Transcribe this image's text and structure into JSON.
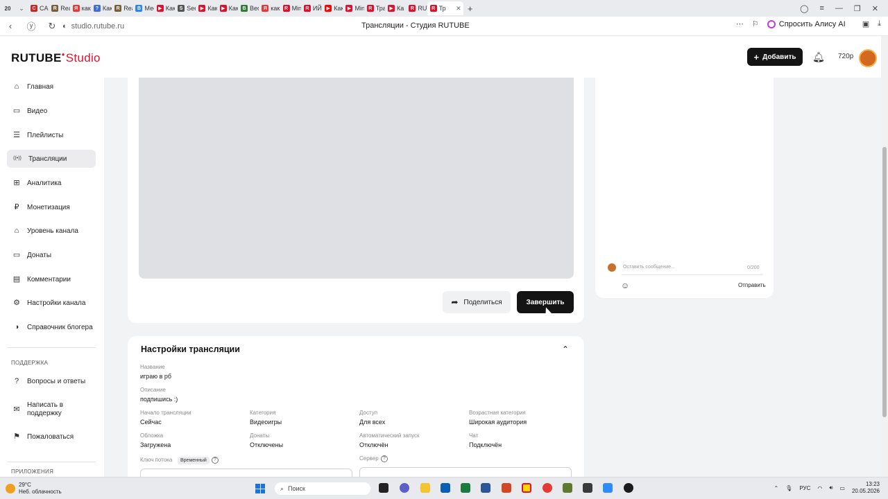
{
  "browser": {
    "tab_counter": "20",
    "tabs": [
      {
        "label": "CAM",
        "color": "#c62828",
        "glyph": "C"
      },
      {
        "label": "Reall",
        "color": "#7b5e3b",
        "glyph": "R"
      },
      {
        "label": "как у",
        "color": "#e53935",
        "glyph": "Я"
      },
      {
        "label": "Как з",
        "color": "#3f6fd8",
        "glyph": "?"
      },
      {
        "label": "Reall",
        "color": "#7b5e3b",
        "glyph": "R"
      },
      {
        "label": "Месс",
        "color": "#2787f5",
        "glyph": "В"
      },
      {
        "label": "Как с",
        "color": "#e0102a",
        "glyph": "▶"
      },
      {
        "label": "Seed",
        "color": "#555555",
        "glyph": "S"
      },
      {
        "label": "Как с",
        "color": "#e0102a",
        "glyph": "▶"
      },
      {
        "label": "Как с",
        "color": "#e0102a",
        "glyph": "▶"
      },
      {
        "label": "Beds",
        "color": "#2e7d32",
        "glyph": "B"
      },
      {
        "label": "как с",
        "color": "#e53935",
        "glyph": "Я"
      },
      {
        "label": "Mine",
        "color": "#e0102a",
        "glyph": "R"
      },
      {
        "label": "ИЙ",
        "color": "#e0102a",
        "glyph": "R"
      },
      {
        "label": "Как н",
        "color": "#ff0000",
        "glyph": "▶"
      },
      {
        "label": "Mine",
        "color": "#e0102a",
        "glyph": "▶"
      },
      {
        "label": "Тран",
        "color": "#e0102a",
        "glyph": "R"
      },
      {
        "label": "Ка м",
        "color": "#e0102a",
        "glyph": "▶"
      },
      {
        "label": "RUTL",
        "color": "#e0102a",
        "glyph": "R"
      }
    ],
    "active_tab": {
      "label": "Тр",
      "color": "#e0102a",
      "glyph": "R"
    },
    "url": "studio.rutube.ru",
    "page_title": "Трансляции - Студия RUTUBE",
    "alice_label": "Спросить Алису AI"
  },
  "header": {
    "logo_main": "RUTUBE",
    "logo_sub": "Studio",
    "add_button": "Добавить",
    "quality": "720p"
  },
  "sidebar": {
    "items": [
      {
        "label": "Главная",
        "icon": "home-icon",
        "glyph": "⌂"
      },
      {
        "label": "Видео",
        "icon": "video-icon",
        "glyph": "▭"
      },
      {
        "label": "Плейлисты",
        "icon": "playlist-icon",
        "glyph": "☰"
      },
      {
        "label": "Трансляции",
        "icon": "broadcast-icon",
        "glyph": "((•))"
      },
      {
        "label": "Аналитика",
        "icon": "analytics-icon",
        "glyph": "⊞"
      },
      {
        "label": "Монетизация",
        "icon": "monetization-icon",
        "glyph": "₽"
      },
      {
        "label": "Уровень канала",
        "icon": "level-icon",
        "glyph": "⌂"
      },
      {
        "label": "Донаты",
        "icon": "donations-icon",
        "glyph": "▭"
      },
      {
        "label": "Комментарии",
        "icon": "comments-icon",
        "glyph": "▤"
      },
      {
        "label": "Настройки канала",
        "icon": "gear-icon",
        "glyph": "⚙"
      },
      {
        "label": "Справочник блогера",
        "icon": "help-book-icon",
        "glyph": "◑"
      }
    ],
    "support_section": "ПОДДЕРЖКА",
    "support_items": [
      {
        "label": "Вопросы и ответы",
        "icon": "faq-icon",
        "glyph": "?"
      },
      {
        "label": "Написать в поддержку",
        "line1": "Написать в",
        "line2": "поддержку",
        "icon": "mail-icon",
        "glyph": "✉"
      },
      {
        "label": "Пожаловаться",
        "icon": "flag-icon",
        "glyph": "⚑"
      }
    ],
    "apps_section": "ПРИЛОЖЕНИЯ"
  },
  "player": {
    "share_button": "Поделиться",
    "end_button": "Завершить"
  },
  "chat": {
    "placeholder": "Оставить сообщение...",
    "counter": "0/200",
    "send_button": "Отправить"
  },
  "settings": {
    "title": "Настройки трансляции",
    "name_label": "Название",
    "name_value": "играю в рб",
    "description_label": "Описание",
    "description_value": "подпишись :)",
    "fields": [
      {
        "label": "Начало трансляции",
        "value": "Сейчас"
      },
      {
        "label": "Категория",
        "value": "Видеоигры"
      },
      {
        "label": "Доступ",
        "value": "Для всех"
      },
      {
        "label": "Возрастная категория",
        "value": "Широкая аудитория"
      },
      {
        "label": "Обложка",
        "value": "Загружена"
      },
      {
        "label": "Донаты",
        "value": "Отключены"
      },
      {
        "label": "Автоматический запуск",
        "value": "Отключён"
      },
      {
        "label": "Чат",
        "value": "Подключён"
      }
    ],
    "stream_key_label": "Ключ потока",
    "stream_key_badge": "Временный",
    "server_label": "Сервер"
  },
  "taskbar": {
    "temperature": "29°C",
    "weather": "Неб. облачность",
    "search_label": "Поиск",
    "language": "РУС",
    "time": "13:23",
    "date": "20.05.2026",
    "accent": "#1e73d6"
  }
}
